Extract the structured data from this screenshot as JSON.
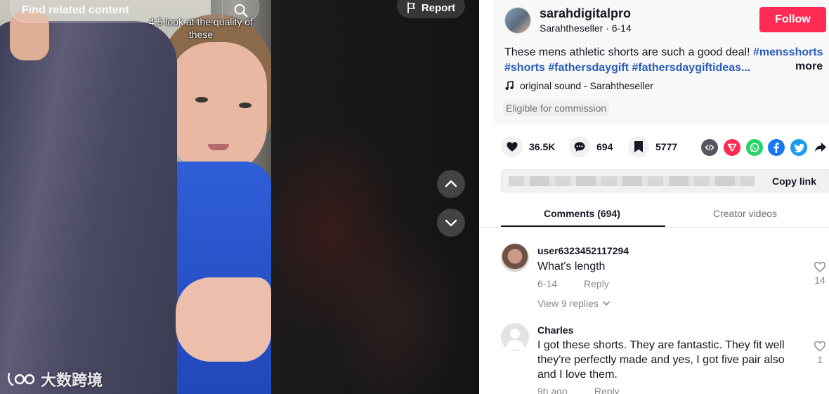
{
  "video": {
    "search_placeholder": "Find related content",
    "caption": "4.5 look at the quality of these",
    "report_label": "Report",
    "watermark": "大数跨境"
  },
  "post": {
    "username": "sarahdigitalpro",
    "sub_line": "Sarahtheseller · 6-14",
    "follow_label": "Follow",
    "description_text": "These mens athletic shorts are such a good deal! ",
    "hashtags_line1": "#mensshorts",
    "hashtags_line2": "#shorts #fathersdaygift #fathersdaygiftideas...",
    "more_label": "more",
    "music": "original sound - Sarahtheseller",
    "commission_label": "Eligible for commission"
  },
  "stats": {
    "likes": "36.5K",
    "comments": "694",
    "saves": "5777"
  },
  "share_icons": [
    "embed-icon",
    "send-icon",
    "whatsapp-icon",
    "facebook-icon",
    "twitter-icon",
    "share-arrow-icon"
  ],
  "colors": {
    "follow": "#fe2c55",
    "hashtag": "#2b5db9",
    "send": "#fe2c55",
    "whatsapp": "#25d366",
    "facebook": "#1877f2",
    "twitter": "#1d9bf0"
  },
  "link": {
    "copy_label": "Copy link"
  },
  "tabs": {
    "comments": "Comments (694)",
    "creator": "Creator videos"
  },
  "comments": [
    {
      "user": "user6323452117294",
      "text": "What's length",
      "date": "6-14",
      "reply_label": "Reply",
      "likes": "14",
      "replies_label": "View 9 replies"
    },
    {
      "user": "Charles",
      "text": "I got these shorts. They are fantastic. They fit well they're perfectly made and yes, I got five pair also and I love them.",
      "date": "9h ago",
      "reply_label": "Reply",
      "likes": "1"
    }
  ]
}
